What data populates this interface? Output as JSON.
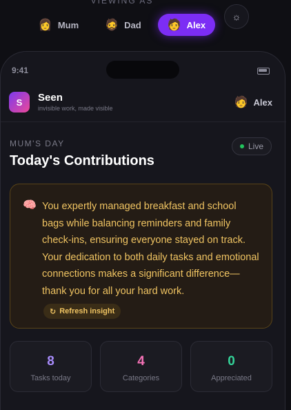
{
  "viewing": {
    "label": "VIEWING AS",
    "profiles": [
      {
        "name": "Mum",
        "emoji": "👩",
        "active": false
      },
      {
        "name": "Dad",
        "emoji": "🧔",
        "active": false
      },
      {
        "name": "Alex",
        "emoji": "🧑",
        "active": true
      }
    ],
    "theme_icon": "☼"
  },
  "status": {
    "time": "9:41"
  },
  "header": {
    "logo_letter": "S",
    "app_name": "Seen",
    "tagline": "invisible work, made visible",
    "user_emoji": "🧑",
    "user_name": "Alex"
  },
  "main": {
    "section_label": "MUM'S DAY",
    "title": "Today's Contributions",
    "live_label": "Live",
    "insight": {
      "icon": "🧠",
      "text": "You expertly managed breakfast and school bags while balancing reminders and family check-ins, ensuring everyone stayed on track. Your dedication to both daily tasks and emotional connections makes a significant difference—thank you for all your hard work.",
      "refresh_icon": "↻",
      "refresh_label": "Refresh insight"
    },
    "stats": [
      {
        "value": "8",
        "label": "Tasks today",
        "color": "#a78bfa"
      },
      {
        "value": "4",
        "label": "Categories",
        "color": "#f472b6"
      },
      {
        "value": "0",
        "label": "Appreciated",
        "color": "#34d399"
      }
    ]
  }
}
